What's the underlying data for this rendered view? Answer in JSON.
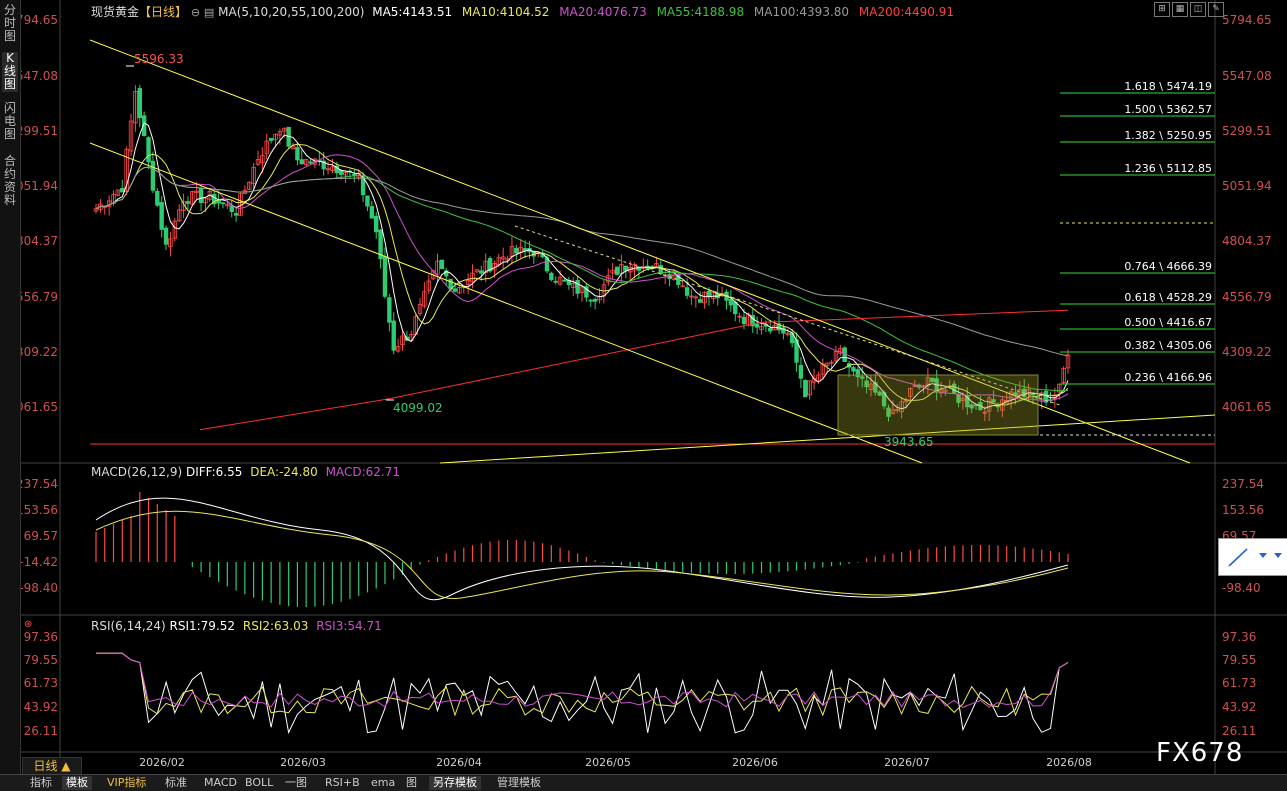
{
  "sidebar": {
    "tabs": [
      {
        "label": "分时图",
        "active": false
      },
      {
        "label": "K线图",
        "active": true
      },
      {
        "label": "闪电图",
        "active": false
      },
      {
        "label": "合约资料",
        "active": false
      }
    ]
  },
  "header": {
    "symbol": "现货黄金",
    "period": "【日线】",
    "ma_params": "MA(5,10,20,55,100,200)",
    "ma5": "MA5:4143.51",
    "ma10": "MA10:4104.52",
    "ma20": "MA20:4076.73",
    "ma55": "MA55:4188.98",
    "ma100": "MA100:4393.80",
    "ma200": "MA200:4490.91"
  },
  "colors": {
    "up": "#ff4a4a",
    "down": "#2ecc71",
    "ma5": "#ffffff",
    "ma10": "#e8e85a",
    "ma20": "#d050d0",
    "ma55": "#3cc43c",
    "ma100": "#9a9a9a",
    "ma200": "#ff3030",
    "trend": "#ffff44",
    "fib": "#33dd33"
  },
  "price_axis": [
    "5794.65",
    "5547.08",
    "5299.51",
    "5051.94",
    "4804.37",
    "4556.79",
    "4309.22",
    "4061.65"
  ],
  "annotations": {
    "high": "5596.33",
    "low1": "4099.02",
    "low2": "3943.65"
  },
  "fib_levels": [
    {
      "label": "1.618 \\ 5474.19"
    },
    {
      "label": "1.500 \\ 5362.57"
    },
    {
      "label": "1.382 \\ 5250.95"
    },
    {
      "label": "1.236 \\ 5112.85"
    },
    {
      "label": "0.764 \\ 4666.39"
    },
    {
      "label": "0.618 \\ 4528.29"
    },
    {
      "label": "0.500 \\ 4416.67"
    },
    {
      "label": "0.382 \\ 4305.06"
    },
    {
      "label": "0.236 \\ 4166.96"
    }
  ],
  "macd": {
    "title": "MACD(26,12,9)",
    "diff": "DIFF:6.55",
    "dea": "DEA:-24.80",
    "macd": "MACD:62.71",
    "axis": [
      "237.54",
      "153.56",
      "69.57",
      "-14.42",
      "-98.40"
    ]
  },
  "rsi": {
    "title": "RSI(6,14,24)",
    "rsi1": "RSI1:79.52",
    "rsi2": "RSI2:63.03",
    "rsi3": "RSI3:54.71",
    "axis": [
      "97.36",
      "79.55",
      "61.73",
      "43.92",
      "26.11"
    ]
  },
  "dates": [
    "2026/02",
    "2026/03",
    "2026/04",
    "2026/05",
    "2026/06",
    "2026/07",
    "2026/08"
  ],
  "bottom_tabs": [
    {
      "label": "指标",
      "active": false
    },
    {
      "label": "模板",
      "active": true
    },
    {
      "label": "VIP指标",
      "active": false,
      "vip": true
    },
    {
      "label": "标准",
      "active": false
    },
    {
      "label": "MACD",
      "active": false
    },
    {
      "label": "BOLL",
      "active": false
    },
    {
      "label": "一图",
      "active": false
    },
    {
      "label": "RSI+B",
      "active": false
    },
    {
      "label": "ema",
      "active": false
    },
    {
      "label": "图",
      "active": false
    },
    {
      "label": "另存模板",
      "active": true
    },
    {
      "label": "管理模板",
      "active": false
    }
  ],
  "day_button": "日线 ▲",
  "watermark": "FX678"
}
